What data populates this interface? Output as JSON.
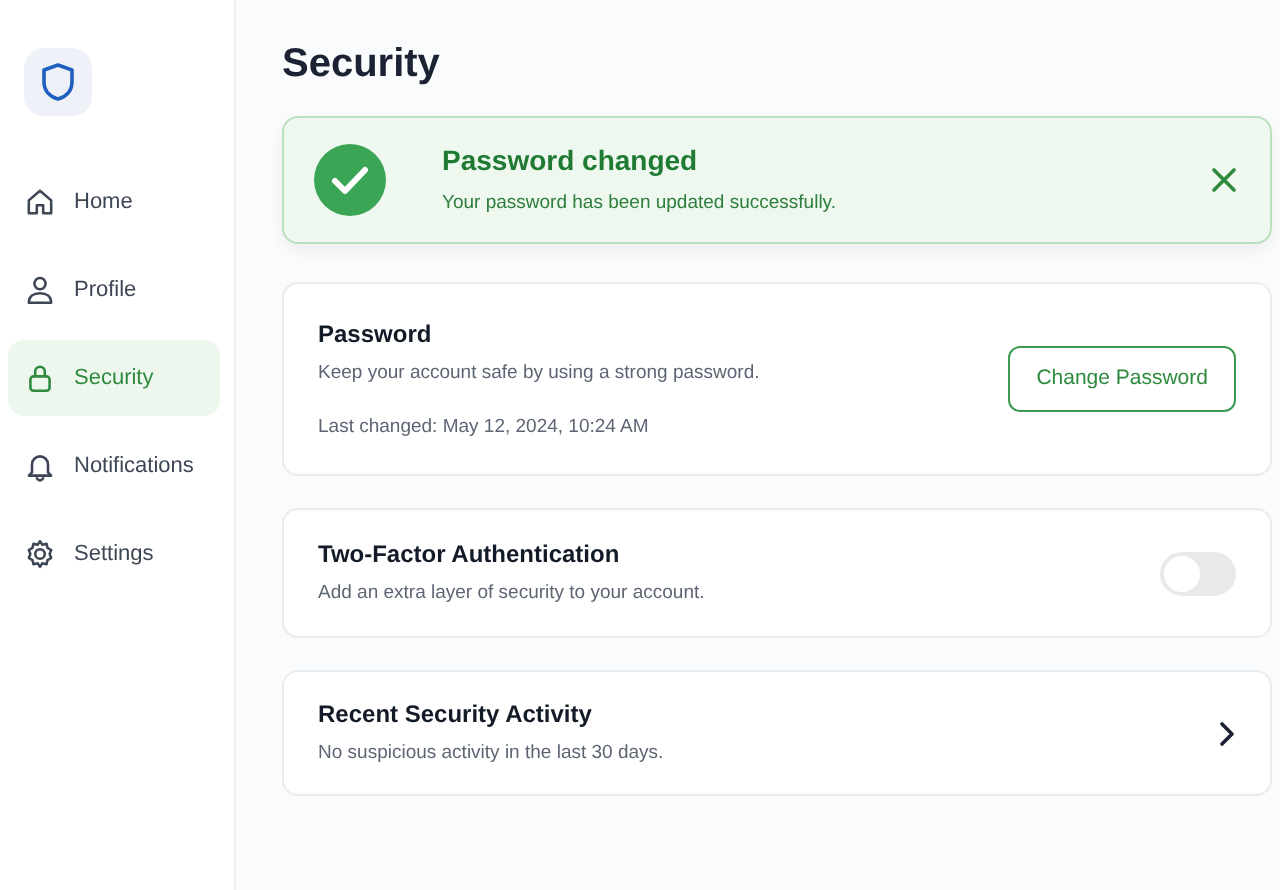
{
  "sidebar": {
    "items": [
      {
        "label": "Home",
        "selected": false
      },
      {
        "label": "Profile",
        "selected": false
      },
      {
        "label": "Security",
        "selected": true
      },
      {
        "label": "Notifications",
        "selected": false
      },
      {
        "label": "Settings",
        "selected": false
      }
    ]
  },
  "page_title": "Security",
  "alert": {
    "title": "Password changed",
    "message": "Your password has been updated successfully."
  },
  "sections": [
    {
      "kind": "action",
      "title": "Password",
      "description": "Keep your account safe by using a strong password.",
      "note": "Last changed: May 12, 2024, 10:24 AM",
      "button": "Change Password"
    },
    {
      "kind": "toggle",
      "title": "Two-Factor Authentication",
      "description": "Add an extra layer of security to your account.",
      "on": false
    },
    {
      "kind": "link",
      "title": "Recent Security Activity",
      "description": "No suspicious activity in the last 30 days."
    }
  ]
}
